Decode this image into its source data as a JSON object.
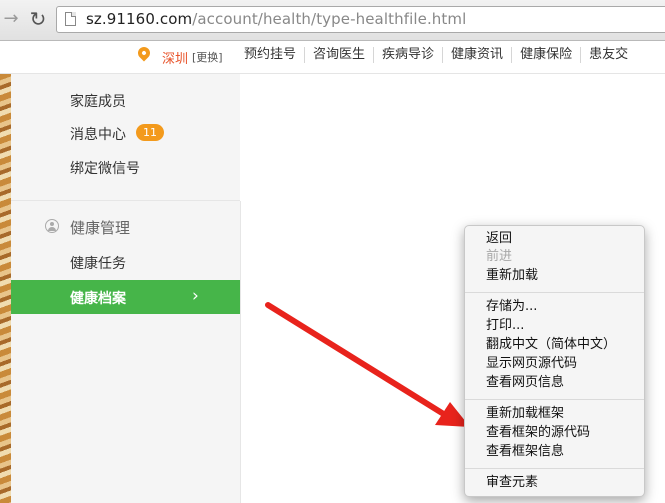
{
  "browser": {
    "url_host": "sz.91160.com",
    "url_path": "/account/health/type-healthfile.html"
  },
  "site_nav": {
    "city": "深圳",
    "city_change": "[更换]",
    "links": [
      "预约挂号",
      "咨询医生",
      "疾病导诊",
      "健康资讯",
      "健康保险",
      "患友交"
    ]
  },
  "sidebar": {
    "top_items": [
      "家庭成员",
      "消息中心",
      "绑定微信号"
    ],
    "message_badge": "11",
    "section_title": "健康管理",
    "section_items": [
      "健康任务",
      "健康档案"
    ],
    "active_item": "健康档案",
    "accent_color": "#46b549"
  },
  "context_menu": {
    "group1": [
      "返回",
      "前进",
      "重新加载"
    ],
    "disabled": [
      "前进"
    ],
    "group2": [
      "存储为...",
      "打印...",
      "翻成中文（简体中文）",
      "显示网页源代码",
      "查看网页信息"
    ],
    "group3": [
      "重新加载框架",
      "查看框架的源代码",
      "查看框架信息"
    ],
    "group4": [
      "审查元素"
    ]
  }
}
